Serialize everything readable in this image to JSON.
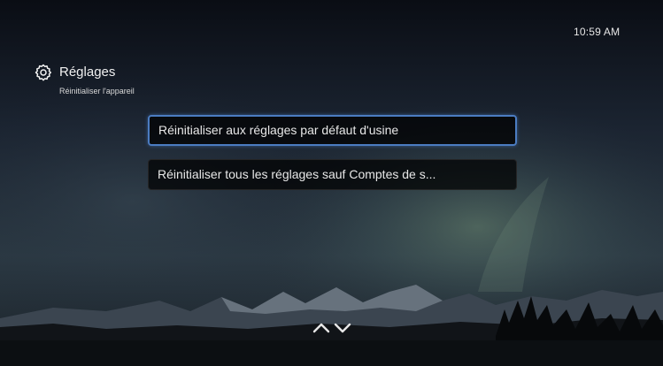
{
  "status": {
    "time": "10:59 AM"
  },
  "header": {
    "title": "Réglages",
    "subtitle": "Réinitialiser l'appareil",
    "icon": "gear-icon"
  },
  "menu": {
    "items": [
      {
        "label": "Réinitialiser aux réglages par défaut d'usine",
        "selected": true
      },
      {
        "label": "Réinitialiser tous les réglages sauf Comptes de s...",
        "selected": false
      }
    ]
  },
  "navigation": {
    "icon": "up-down-arrows-icon"
  },
  "colors": {
    "selection_border": "#4b7cc1",
    "item_background": "#000000"
  }
}
